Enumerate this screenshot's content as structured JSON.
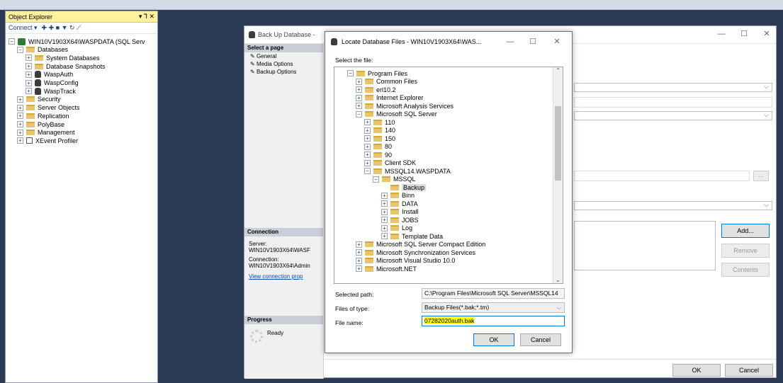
{
  "object_explorer": {
    "title": "Object Explorer",
    "pin": "▾ ⅂ ✕",
    "connect": "Connect ▾",
    "toolbar_icons": "✚ ✚ ■ ▼ ↻ ⟋",
    "tree": [
      {
        "label": "WIN10V1903X64\\WASPDATA (SQL Serv",
        "icon": "server-icon",
        "exp": "−"
      },
      {
        "label": "Databases",
        "icon": "folder-icon",
        "exp": "−"
      },
      {
        "label": "System Databases",
        "icon": "folder-icon",
        "exp": "+"
      },
      {
        "label": "Database Snapshots",
        "icon": "folder-icon",
        "exp": "+"
      },
      {
        "label": "WaspAuth",
        "icon": "database-icon",
        "exp": "+"
      },
      {
        "label": "WaspConfig",
        "icon": "database-icon",
        "exp": "+"
      },
      {
        "label": "WaspTrack",
        "icon": "database-icon",
        "exp": "+"
      },
      {
        "label": "Security",
        "icon": "folder-icon",
        "exp": "+"
      },
      {
        "label": "Server Objects",
        "icon": "folder-icon",
        "exp": "+"
      },
      {
        "label": "Replication",
        "icon": "folder-icon",
        "exp": "+"
      },
      {
        "label": "PolyBase",
        "icon": "folder-icon",
        "exp": "+"
      },
      {
        "label": "Management",
        "icon": "folder-icon",
        "exp": "+"
      },
      {
        "label": "XEvent Profiler",
        "icon": "xevent-icon",
        "exp": "+"
      }
    ]
  },
  "backup": {
    "title": "Back Up Database -",
    "select_page": "Select a page",
    "pages": [
      "General",
      "Media Options",
      "Backup Options"
    ],
    "connection_header": "Connection",
    "server_label": "Server:",
    "server_value": "WIN10V1903X64\\WASF",
    "connection_label": "Connection:",
    "connection_value": "WIN10V1903X64\\Admin",
    "view_link": "View connection prop",
    "progress_header": "Progress",
    "progress_status": "Ready",
    "add": "Add...",
    "remove": "Remove",
    "contents": "Contents",
    "ok": "OK",
    "cancel": "Cancel",
    "browse": "..."
  },
  "locate": {
    "title": "Locate Database Files - WIN10V1903X64\\WAS...",
    "select_file": "Select the file:",
    "tree": [
      {
        "label": "Program Files",
        "exp": "−",
        "selected": false
      },
      {
        "label": "Common Files",
        "exp": "+",
        "selected": false
      },
      {
        "label": "erl10.2",
        "exp": "+",
        "selected": false
      },
      {
        "label": "Internet Explorer",
        "exp": "+",
        "selected": false
      },
      {
        "label": "Microsoft Analysis Services",
        "exp": "+",
        "selected": false
      },
      {
        "label": "Microsoft SQL Server",
        "exp": "−",
        "selected": false
      },
      {
        "label": "110",
        "exp": "+",
        "selected": false
      },
      {
        "label": "140",
        "exp": "+",
        "selected": false
      },
      {
        "label": "150",
        "exp": "+",
        "selected": false
      },
      {
        "label": "80",
        "exp": "+",
        "selected": false
      },
      {
        "label": "90",
        "exp": "+",
        "selected": false
      },
      {
        "label": "Client SDK",
        "exp": "+",
        "selected": false
      },
      {
        "label": "MSSQL14.WASPDATA",
        "exp": "−",
        "selected": false
      },
      {
        "label": "MSSQL",
        "exp": "−",
        "selected": false
      },
      {
        "label": "Backup",
        "exp": "",
        "selected": true
      },
      {
        "label": "Binn",
        "exp": "+",
        "selected": false
      },
      {
        "label": "DATA",
        "exp": "+",
        "selected": false
      },
      {
        "label": "Install",
        "exp": "+",
        "selected": false
      },
      {
        "label": "JOBS",
        "exp": "+",
        "selected": false
      },
      {
        "label": "Log",
        "exp": "+",
        "selected": false
      },
      {
        "label": "Template Data",
        "exp": "+",
        "selected": false
      },
      {
        "label": "Microsoft SQL Server Compact Edition",
        "exp": "+",
        "selected": false
      },
      {
        "label": "Microsoft Synchronization Services",
        "exp": "+",
        "selected": false
      },
      {
        "label": "Microsoft Visual Studio 10.0",
        "exp": "+",
        "selected": false
      },
      {
        "label": "Microsoft.NET",
        "exp": "+",
        "selected": false
      }
    ],
    "selected_path_label": "Selected path:",
    "selected_path_value": "C:\\Program Files\\Microsoft SQL Server\\MSSQL14",
    "files_of_type_label": "Files of type:",
    "files_of_type_value": "Backup Files(*.bak;*.tm)",
    "file_name_label": "File name:",
    "file_name_value": "07282020auth.bak",
    "ok": "OK",
    "cancel": "Cancel"
  },
  "colors": {
    "highlight": "#ffff00",
    "accent": "#0078d7",
    "panel_title": "#fff19d"
  }
}
